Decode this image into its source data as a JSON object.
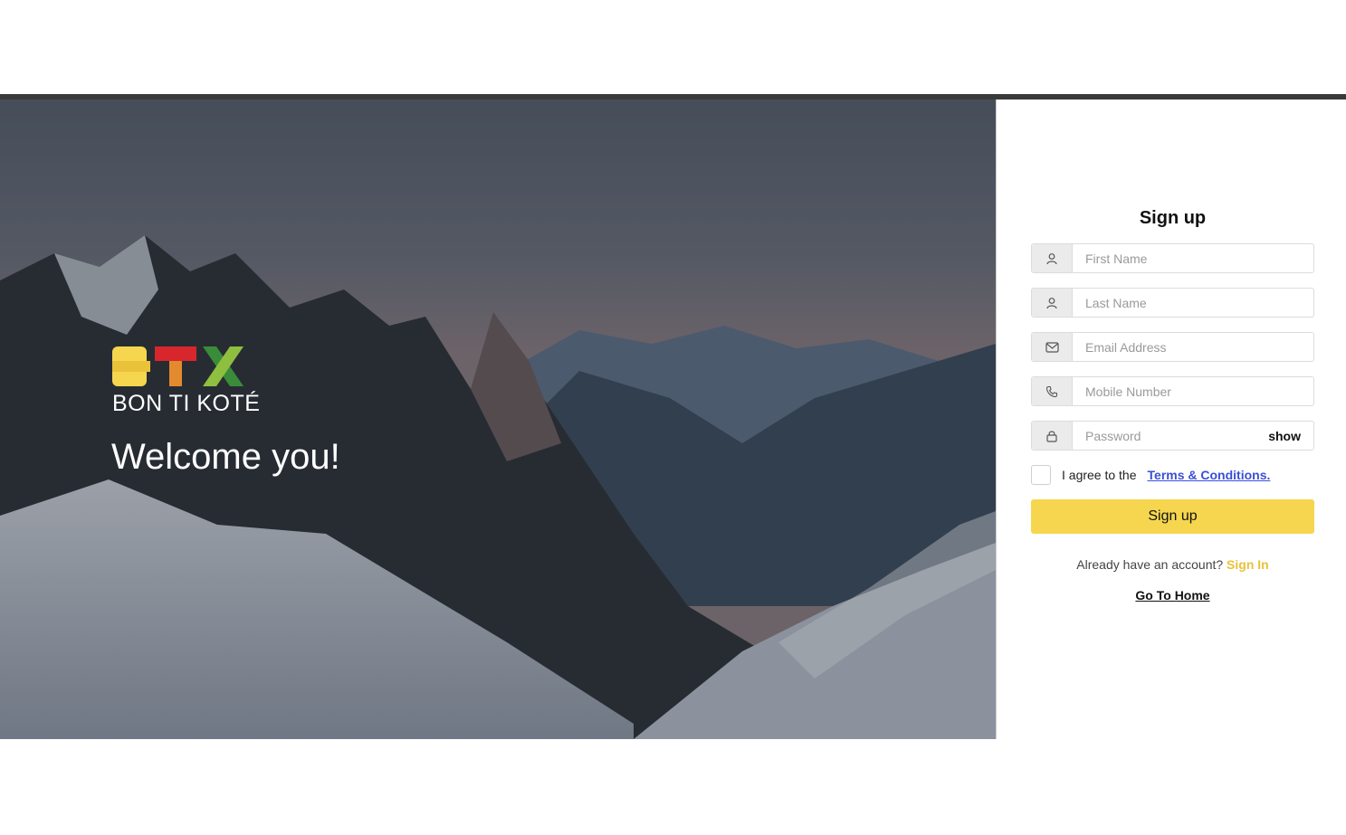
{
  "brand": {
    "logo_text": "BON TI KOTÉ",
    "logo_letters": "BTX",
    "colors": {
      "yellow": "#f5d64e",
      "red": "#d8262d",
      "green": "#3a8c3a"
    }
  },
  "hero": {
    "welcome": "Welcome you!"
  },
  "form": {
    "title": "Sign up",
    "fields": {
      "first_name": {
        "placeholder": "First Name",
        "icon": "user-icon"
      },
      "last_name": {
        "placeholder": "Last Name",
        "icon": "user-icon"
      },
      "email": {
        "placeholder": "Email Address",
        "icon": "mail-icon"
      },
      "mobile": {
        "placeholder": "Mobile Number",
        "icon": "phone-icon"
      },
      "password": {
        "placeholder": "Password",
        "icon": "lock-icon",
        "toggle": "show"
      }
    },
    "agree_text": "I agree to the",
    "terms_link": "Terms & Conditions.",
    "submit": "Sign up",
    "already_text": "Already have an account?",
    "signin_link": "Sign In",
    "home_link": "Go To Home"
  },
  "colors": {
    "accent": "#f5d64e",
    "link": "#3b4fd6",
    "signin": "#e9c23a"
  }
}
